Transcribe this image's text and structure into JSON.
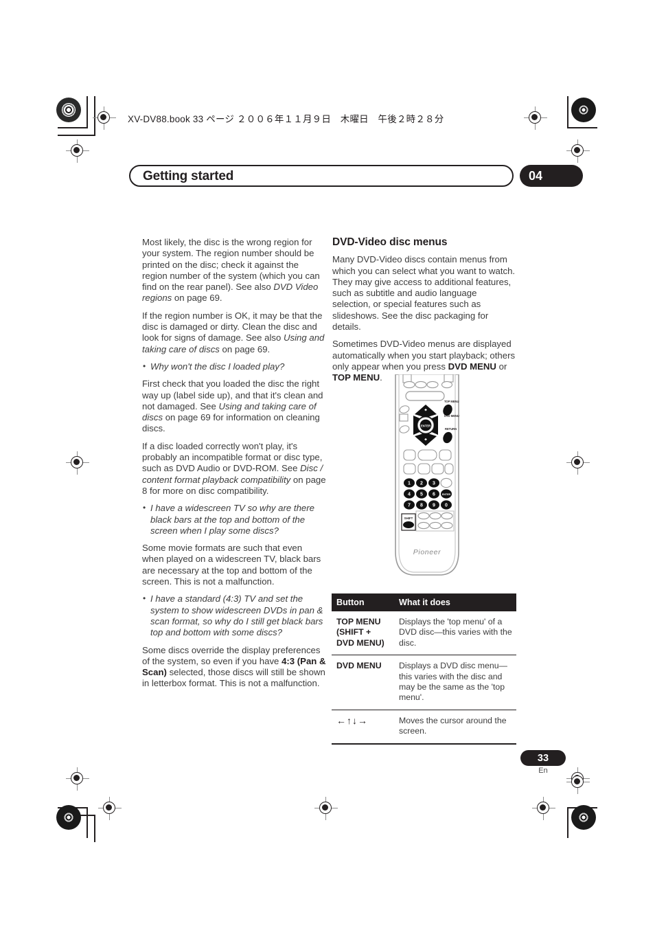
{
  "print_header": {
    "text": "XV-DV88.book  33 ページ  ２００６年１１月９日　木曜日　午後２時２８分"
  },
  "banner": {
    "title": "Getting started",
    "chapter": "04"
  },
  "left_column": {
    "p1": "Most likely, the disc is the wrong region for your system. The region number should be printed on the disc; check it against the region number of the system (which you can find on the rear panel). See also ",
    "p1_italic": "DVD Video regions",
    "p1_end": " on page 69.",
    "p2": "If the region number is OK, it may be that the disc is damaged or dirty. Clean the disc and look for signs of damage. See also ",
    "p2_italic": "Using and taking care of discs",
    "p2_end": " on page 69.",
    "q1": "Why won't the disc I loaded play?",
    "p3": "First check that you loaded the disc the right way up (label side up), and that it's clean and not damaged. See ",
    "p3_italic": "Using and taking care of discs",
    "p3_end": " on page 69 for information on cleaning discs.",
    "p4": "If a disc loaded correctly won't play, it's probably an incompatible format or disc type, such as DVD Audio or DVD-ROM. See ",
    "p4_italic": "Disc / content format playback compatibility",
    "p4_end": " on page 8 for more on disc compatibility.",
    "q2": "I have a widescreen TV so why are there black bars at the top and bottom of the screen when I play some discs?",
    "p5": "Some movie formats are such that even when played on a widescreen TV, black bars are necessary at the top and bottom of the screen. This is not a malfunction.",
    "q3": "I have a standard (4:3) TV and set the system to show widescreen DVDs in pan & scan format, so why do I still get black bars top and bottom with some discs?",
    "p6": "Some discs override the display preferences of the system, so even if you have ",
    "p6_bold": "4:3 (Pan & Scan)",
    "p6_end": " selected, those discs will still be shown in letterbox format. This is not a malfunction."
  },
  "right_column": {
    "heading": "DVD-Video disc menus",
    "p1": "Many DVD-Video discs contain menus from which you can select what you want to watch. They may give access to additional features, such as subtitle and audio language selection, or special features such as slideshows. See the disc packaging for details.",
    "p2": "Sometimes DVD-Video menus are displayed automatically when you start playback; others only appear when you press ",
    "p2_bold1": "DVD MENU",
    "p2_mid": " or ",
    "p2_bold2": "TOP MENU",
    "p2_end": "."
  },
  "remote": {
    "brand": "Pioneer",
    "label_top_menu": "TOP MENU",
    "label_dvd_menu": "DVD MENU",
    "label_return": "RETURN",
    "label_enter": "ENTER",
    "label_shift": "SHIFT",
    "label_enter_key": "ENTER",
    "keys": [
      "1",
      "2",
      "3",
      "4",
      "5",
      "6",
      "7",
      "8",
      "9",
      "0"
    ]
  },
  "button_table": {
    "headers": [
      "Button",
      "What it does"
    ],
    "rows": [
      {
        "button": "TOP MENU (SHIFT + DVD MENU)",
        "does": "Displays the 'top menu' of a DVD disc—this varies with the disc."
      },
      {
        "button": "DVD MENU",
        "does": "Displays a DVD disc menu—this varies with the disc and may be the same as the 'top menu'."
      },
      {
        "button": "←↑↓→",
        "does": "Moves the cursor around the screen."
      }
    ]
  },
  "footer": {
    "page_number": "33",
    "language": "En"
  },
  "colors": {
    "ink": "#231f20",
    "body_text": "#3b3b3b",
    "paper": "#ffffff"
  }
}
